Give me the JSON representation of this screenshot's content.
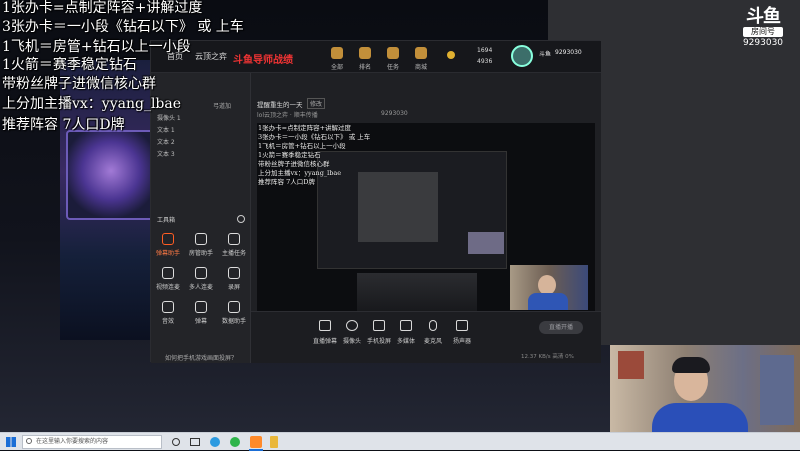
{
  "overlay": {
    "lines": [
      "1张办卡=点制定阵容+讲解过度",
      "3张办卡＝一小段《钻石以下》 或 上车",
      "1飞机＝房管+钻石以上一小段",
      "1火箭＝赛季稳定钻石",
      "带粉丝牌子进微信核心群",
      "上分加主播vx：yyang_lbae",
      "推荐阵容  7人口D牌"
    ]
  },
  "room_badge": {
    "logo": "斗鱼",
    "subtitle": "房间号",
    "room_number": "9293030"
  },
  "top_nav": {
    "tabs": [
      "首页",
      "云顶之弈"
    ],
    "banner": "斗鱼导师战绩",
    "items": [
      "全部",
      "排名",
      "任务",
      "商城"
    ],
    "coins_1": "1694",
    "coins_2": "4936",
    "user_name": "斗鱼",
    "user_id": "9293030"
  },
  "obs": {
    "panel_title": "弓道加",
    "scenes": [
      "摄像头 1",
      "文本 1",
      "文本 2",
      "文本 3"
    ],
    "toolbox_label": "工具箱",
    "tools": [
      "弹幕助手",
      "房管助手",
      "主播任务",
      "视频连麦",
      "多人连麦",
      "录屏",
      "音效",
      "弹幕",
      "数据助手"
    ],
    "footer_tip": "如何把手机游戏画面投屏？",
    "title": "提醒重生的一天",
    "title_tag": "修改",
    "breadcrumb": "lol云顶之弈 · 顺丰传播",
    "room_no": "9293030",
    "bottom_tools": [
      "直播弹幕",
      "摄像头",
      "手机投屏",
      "多媒体",
      "麦克风",
      "扬声器"
    ],
    "start_button": "直播开播",
    "stats": "12.37 KB/s  高清  0%"
  },
  "taskbar": {
    "search_placeholder": "在这里输入你要搜索的内容"
  },
  "colors": {
    "accent": "#ff5d23",
    "banner": "#e33333"
  }
}
